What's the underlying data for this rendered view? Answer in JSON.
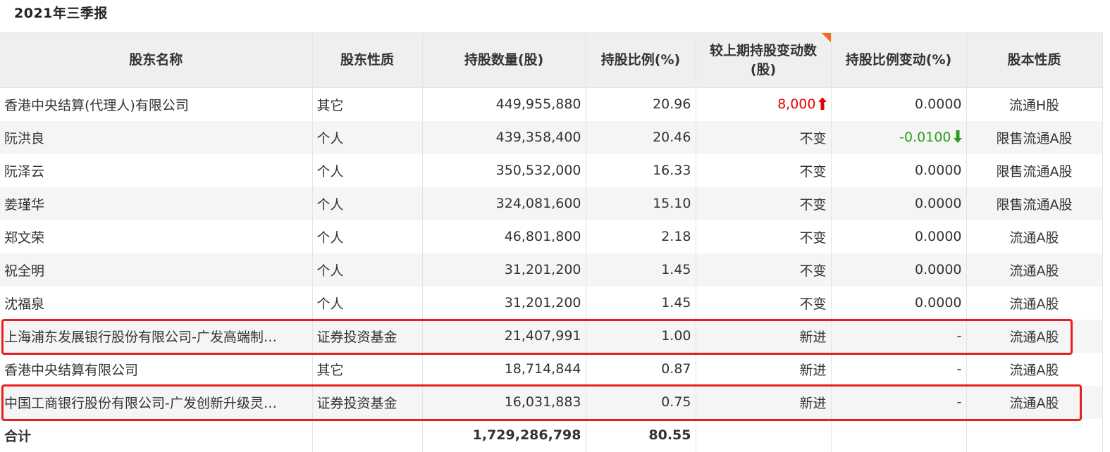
{
  "report": {
    "title": "2021年三季报"
  },
  "table": {
    "columns": [
      "股东名称",
      "股东性质",
      "持股数量(股)",
      "持股比例(%)",
      "较上期持股变动数(股)",
      "持股比例变动(%)",
      "股本性质"
    ],
    "rows": [
      {
        "name": "香港中央结算(代理人)有限公司",
        "type": "其它",
        "shares": "449,955,880",
        "ratio": "20.96",
        "change": "8,000",
        "change_dir": "up",
        "ratio_change": "0.0000",
        "ratio_change_dir": "",
        "share_type": "流通H股"
      },
      {
        "name": "阮洪良",
        "type": "个人",
        "shares": "439,358,400",
        "ratio": "20.46",
        "change": "不变",
        "change_dir": "",
        "ratio_change": "-0.0100",
        "ratio_change_dir": "down",
        "share_type": "限售流通A股"
      },
      {
        "name": "阮泽云",
        "type": "个人",
        "shares": "350,532,000",
        "ratio": "16.33",
        "change": "不变",
        "change_dir": "",
        "ratio_change": "0.0000",
        "ratio_change_dir": "",
        "share_type": "限售流通A股"
      },
      {
        "name": "姜瑾华",
        "type": "个人",
        "shares": "324,081,600",
        "ratio": "15.10",
        "change": "不变",
        "change_dir": "",
        "ratio_change": "0.0000",
        "ratio_change_dir": "",
        "share_type": "限售流通A股"
      },
      {
        "name": "郑文荣",
        "type": "个人",
        "shares": "46,801,800",
        "ratio": "2.18",
        "change": "不变",
        "change_dir": "",
        "ratio_change": "0.0000",
        "ratio_change_dir": "",
        "share_type": "流通A股"
      },
      {
        "name": "祝全明",
        "type": "个人",
        "shares": "31,201,200",
        "ratio": "1.45",
        "change": "不变",
        "change_dir": "",
        "ratio_change": "0.0000",
        "ratio_change_dir": "",
        "share_type": "流通A股"
      },
      {
        "name": "沈福泉",
        "type": "个人",
        "shares": "31,201,200",
        "ratio": "1.45",
        "change": "不变",
        "change_dir": "",
        "ratio_change": "0.0000",
        "ratio_change_dir": "",
        "share_type": "流通A股"
      },
      {
        "name": "上海浦东发展银行股份有限公司-广发高端制…",
        "type": "证券投资基金",
        "shares": "21,407,991",
        "ratio": "1.00",
        "change": "新进",
        "change_dir": "",
        "ratio_change": "-",
        "ratio_change_dir": "",
        "share_type": "流通A股"
      },
      {
        "name": "香港中央结算有限公司",
        "type": "其它",
        "shares": "18,714,844",
        "ratio": "0.87",
        "change": "新进",
        "change_dir": "",
        "ratio_change": "-",
        "ratio_change_dir": "",
        "share_type": "流通A股"
      },
      {
        "name": "中国工商银行股份有限公司-广发创新升级灵…",
        "type": "证券投资基金",
        "shares": "16,031,883",
        "ratio": "0.75",
        "change": "新进",
        "change_dir": "",
        "ratio_change": "-",
        "ratio_change_dir": "",
        "share_type": "流通A股"
      }
    ],
    "total": {
      "label": "合计",
      "shares": "1,729,286,798",
      "ratio": "80.55"
    }
  },
  "colors": {
    "up": "#e60000",
    "down": "#2e9c1e",
    "highlight": "#e8201d",
    "header_bg": "#efefef",
    "stripe_bg": "#f5f5f5",
    "corner_flag": "#f26b1d"
  },
  "icons": {
    "increase": "arrow-up-icon",
    "decrease": "arrow-down-icon"
  }
}
